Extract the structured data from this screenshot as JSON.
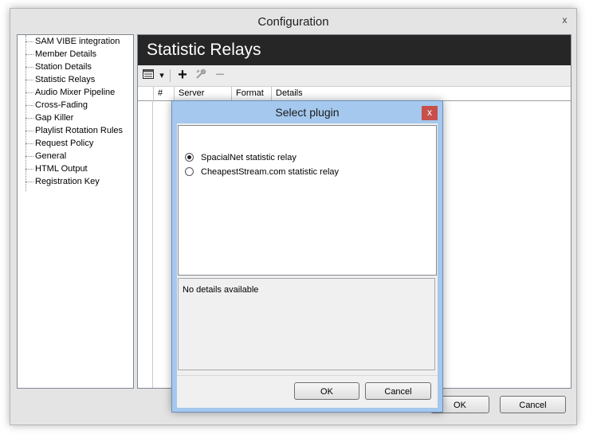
{
  "window": {
    "title": "Configuration",
    "close_glyph": "x"
  },
  "tree": {
    "items": [
      "SAM VIBE integration",
      "Member Details",
      "Station Details",
      "Statistic Relays",
      "Audio Mixer Pipeline",
      "Cross-Fading",
      "Gap Killer",
      "Playlist Rotation Rules",
      "Request Policy",
      "General",
      "HTML Output",
      "Registration Key"
    ]
  },
  "panel": {
    "header": "Statistic Relays",
    "toolbar": {
      "view_icon": "list-view-icon",
      "dropdown_glyph": "▾",
      "add_glyph": "+",
      "edit_icon": "tools-icon",
      "remove_glyph": "−"
    },
    "columns": [
      "#",
      "Server",
      "Format",
      "Details"
    ]
  },
  "buttons": {
    "ok": "OK",
    "cancel": "Cancel"
  },
  "dialog": {
    "title": "Select plugin",
    "close_glyph": "x",
    "options": [
      {
        "label": "SpacialNet statistic relay",
        "selected": true
      },
      {
        "label": "CheapestStream.com statistic relay",
        "selected": false
      }
    ],
    "details": "No details available",
    "ok": "OK",
    "cancel": "Cancel"
  }
}
